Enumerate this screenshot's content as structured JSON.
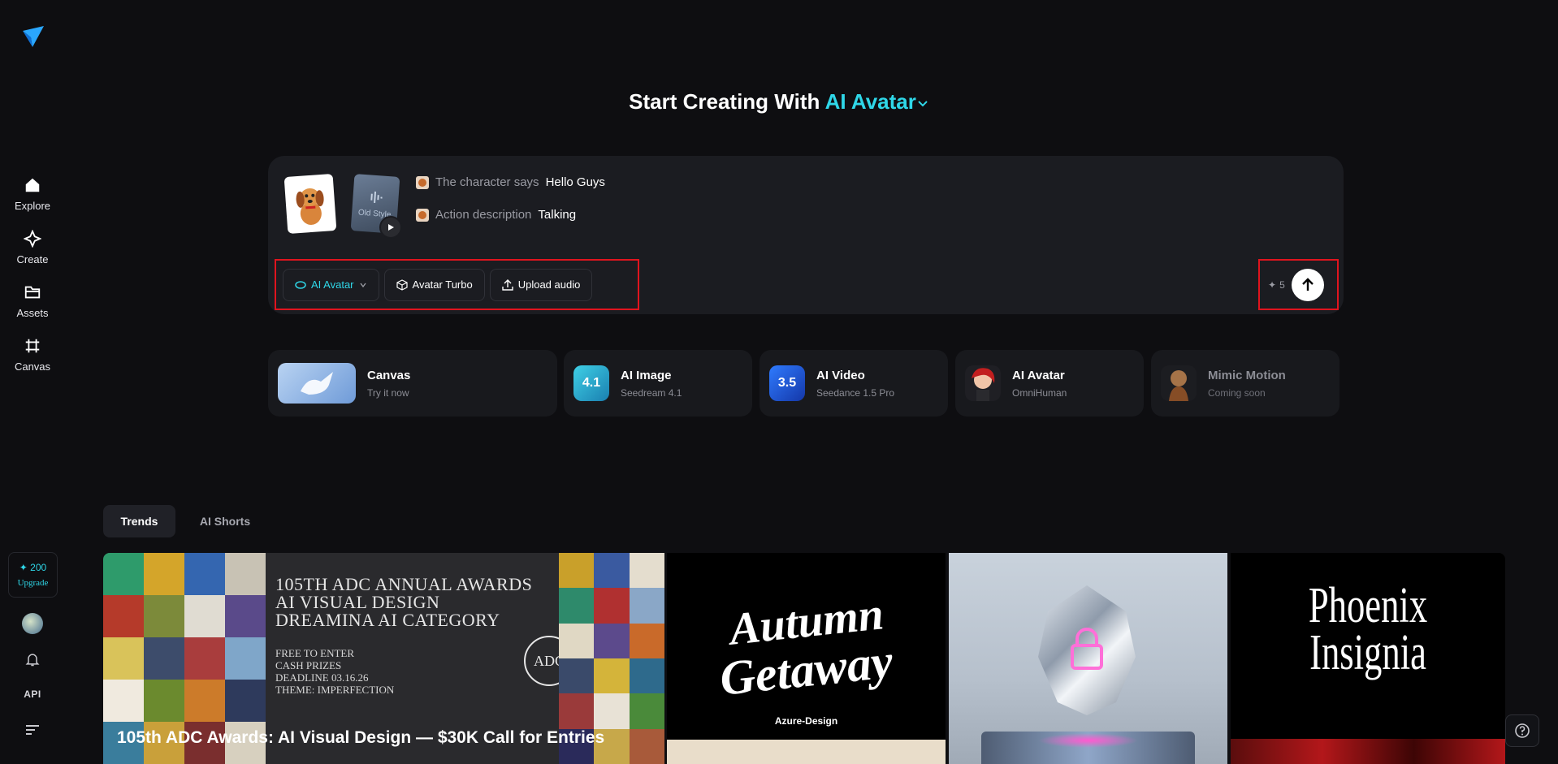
{
  "headline": {
    "prefix": "Start Creating With",
    "accent": "AI Avatar"
  },
  "sidebar": {
    "items": [
      {
        "label": "Explore",
        "icon": "home-icon"
      },
      {
        "label": "Create",
        "icon": "sparkle-icon"
      },
      {
        "label": "Assets",
        "icon": "folder-icon"
      },
      {
        "label": "Canvas",
        "icon": "canvas-icon"
      }
    ],
    "credits": "200",
    "upgrade": "Upgrade",
    "api": "API"
  },
  "prompt": {
    "audio_thumb_label": "Old Style",
    "line1_key": "The character says",
    "line1_val": "Hello Guys",
    "line2_key": "Action description",
    "line2_val": "Talking"
  },
  "toolbar": {
    "mode": "AI Avatar",
    "model": "Avatar Turbo",
    "upload": "Upload audio",
    "cost": "5"
  },
  "features": [
    {
      "title": "Canvas",
      "sub": "Try it now"
    },
    {
      "title": "AI Image",
      "sub": "Seedream 4.1",
      "badge": "4.1"
    },
    {
      "title": "AI Video",
      "sub": "Seedance 1.5 Pro",
      "badge": "3.5"
    },
    {
      "title": "AI Avatar",
      "sub": "OmniHuman"
    },
    {
      "title": "Mimic Motion",
      "sub": "Coming soon"
    }
  ],
  "tabs": {
    "trends": "Trends",
    "shorts": "AI Shorts"
  },
  "cards": {
    "adc_lines": [
      "105TH ADC ANNUAL AWARDS",
      "AI VISUAL DESIGN",
      "DREAMINA AI CATEGORY"
    ],
    "adc_small": [
      "FREE TO ENTER",
      "CASH PRIZES",
      "DEADLINE 03.16.26",
      "THEME: IMPERFECTION"
    ],
    "adc_logo": "ADC",
    "adc_caption": "105th ADC Awards: AI Visual Design — $30K Call for Entries",
    "autumn_w1": "Autumn",
    "autumn_w2": "Getaway",
    "autumn_brand": "Azure-Design",
    "phoenix_w1": "Phoenix",
    "phoenix_w2": "Insignia"
  },
  "colors": {
    "accent": "#2fd7e8",
    "highlight": "#e0141e",
    "background": "#0e0e11"
  }
}
